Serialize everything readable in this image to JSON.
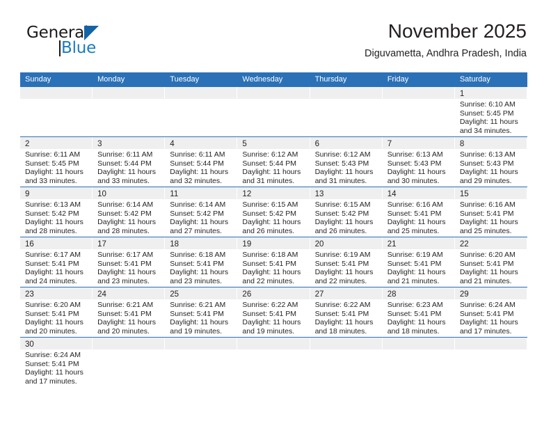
{
  "brand": {
    "name_part1": "General",
    "name_part2": "Blue",
    "triangle_color": "#1464a5",
    "blue_color": "#1b7ac4"
  },
  "header": {
    "title": "November 2025",
    "subtitle": "Diguvametta, Andhra Pradesh, India"
  },
  "theme": {
    "header_blue": "#2b71b8",
    "daynum_band": "#efefef",
    "text": "#231f20"
  },
  "weekday_headers": [
    "Sunday",
    "Monday",
    "Tuesday",
    "Wednesday",
    "Thursday",
    "Friday",
    "Saturday"
  ],
  "weeks": [
    [
      {
        "day": "",
        "sunrise": "",
        "sunset": "",
        "daylight_line1": "",
        "daylight_line2": ""
      },
      {
        "day": "",
        "sunrise": "",
        "sunset": "",
        "daylight_line1": "",
        "daylight_line2": ""
      },
      {
        "day": "",
        "sunrise": "",
        "sunset": "",
        "daylight_line1": "",
        "daylight_line2": ""
      },
      {
        "day": "",
        "sunrise": "",
        "sunset": "",
        "daylight_line1": "",
        "daylight_line2": ""
      },
      {
        "day": "",
        "sunrise": "",
        "sunset": "",
        "daylight_line1": "",
        "daylight_line2": ""
      },
      {
        "day": "",
        "sunrise": "",
        "sunset": "",
        "daylight_line1": "",
        "daylight_line2": ""
      },
      {
        "day": "1",
        "sunrise": "Sunrise: 6:10 AM",
        "sunset": "Sunset: 5:45 PM",
        "daylight_line1": "Daylight: 11 hours",
        "daylight_line2": "and 34 minutes."
      }
    ],
    [
      {
        "day": "2",
        "sunrise": "Sunrise: 6:11 AM",
        "sunset": "Sunset: 5:45 PM",
        "daylight_line1": "Daylight: 11 hours",
        "daylight_line2": "and 33 minutes."
      },
      {
        "day": "3",
        "sunrise": "Sunrise: 6:11 AM",
        "sunset": "Sunset: 5:44 PM",
        "daylight_line1": "Daylight: 11 hours",
        "daylight_line2": "and 33 minutes."
      },
      {
        "day": "4",
        "sunrise": "Sunrise: 6:11 AM",
        "sunset": "Sunset: 5:44 PM",
        "daylight_line1": "Daylight: 11 hours",
        "daylight_line2": "and 32 minutes."
      },
      {
        "day": "5",
        "sunrise": "Sunrise: 6:12 AM",
        "sunset": "Sunset: 5:44 PM",
        "daylight_line1": "Daylight: 11 hours",
        "daylight_line2": "and 31 minutes."
      },
      {
        "day": "6",
        "sunrise": "Sunrise: 6:12 AM",
        "sunset": "Sunset: 5:43 PM",
        "daylight_line1": "Daylight: 11 hours",
        "daylight_line2": "and 31 minutes."
      },
      {
        "day": "7",
        "sunrise": "Sunrise: 6:13 AM",
        "sunset": "Sunset: 5:43 PM",
        "daylight_line1": "Daylight: 11 hours",
        "daylight_line2": "and 30 minutes."
      },
      {
        "day": "8",
        "sunrise": "Sunrise: 6:13 AM",
        "sunset": "Sunset: 5:43 PM",
        "daylight_line1": "Daylight: 11 hours",
        "daylight_line2": "and 29 minutes."
      }
    ],
    [
      {
        "day": "9",
        "sunrise": "Sunrise: 6:13 AM",
        "sunset": "Sunset: 5:42 PM",
        "daylight_line1": "Daylight: 11 hours",
        "daylight_line2": "and 28 minutes."
      },
      {
        "day": "10",
        "sunrise": "Sunrise: 6:14 AM",
        "sunset": "Sunset: 5:42 PM",
        "daylight_line1": "Daylight: 11 hours",
        "daylight_line2": "and 28 minutes."
      },
      {
        "day": "11",
        "sunrise": "Sunrise: 6:14 AM",
        "sunset": "Sunset: 5:42 PM",
        "daylight_line1": "Daylight: 11 hours",
        "daylight_line2": "and 27 minutes."
      },
      {
        "day": "12",
        "sunrise": "Sunrise: 6:15 AM",
        "sunset": "Sunset: 5:42 PM",
        "daylight_line1": "Daylight: 11 hours",
        "daylight_line2": "and 26 minutes."
      },
      {
        "day": "13",
        "sunrise": "Sunrise: 6:15 AM",
        "sunset": "Sunset: 5:42 PM",
        "daylight_line1": "Daylight: 11 hours",
        "daylight_line2": "and 26 minutes."
      },
      {
        "day": "14",
        "sunrise": "Sunrise: 6:16 AM",
        "sunset": "Sunset: 5:41 PM",
        "daylight_line1": "Daylight: 11 hours",
        "daylight_line2": "and 25 minutes."
      },
      {
        "day": "15",
        "sunrise": "Sunrise: 6:16 AM",
        "sunset": "Sunset: 5:41 PM",
        "daylight_line1": "Daylight: 11 hours",
        "daylight_line2": "and 25 minutes."
      }
    ],
    [
      {
        "day": "16",
        "sunrise": "Sunrise: 6:17 AM",
        "sunset": "Sunset: 5:41 PM",
        "daylight_line1": "Daylight: 11 hours",
        "daylight_line2": "and 24 minutes."
      },
      {
        "day": "17",
        "sunrise": "Sunrise: 6:17 AM",
        "sunset": "Sunset: 5:41 PM",
        "daylight_line1": "Daylight: 11 hours",
        "daylight_line2": "and 23 minutes."
      },
      {
        "day": "18",
        "sunrise": "Sunrise: 6:18 AM",
        "sunset": "Sunset: 5:41 PM",
        "daylight_line1": "Daylight: 11 hours",
        "daylight_line2": "and 23 minutes."
      },
      {
        "day": "19",
        "sunrise": "Sunrise: 6:18 AM",
        "sunset": "Sunset: 5:41 PM",
        "daylight_line1": "Daylight: 11 hours",
        "daylight_line2": "and 22 minutes."
      },
      {
        "day": "20",
        "sunrise": "Sunrise: 6:19 AM",
        "sunset": "Sunset: 5:41 PM",
        "daylight_line1": "Daylight: 11 hours",
        "daylight_line2": "and 22 minutes."
      },
      {
        "day": "21",
        "sunrise": "Sunrise: 6:19 AM",
        "sunset": "Sunset: 5:41 PM",
        "daylight_line1": "Daylight: 11 hours",
        "daylight_line2": "and 21 minutes."
      },
      {
        "day": "22",
        "sunrise": "Sunrise: 6:20 AM",
        "sunset": "Sunset: 5:41 PM",
        "daylight_line1": "Daylight: 11 hours",
        "daylight_line2": "and 21 minutes."
      }
    ],
    [
      {
        "day": "23",
        "sunrise": "Sunrise: 6:20 AM",
        "sunset": "Sunset: 5:41 PM",
        "daylight_line1": "Daylight: 11 hours",
        "daylight_line2": "and 20 minutes."
      },
      {
        "day": "24",
        "sunrise": "Sunrise: 6:21 AM",
        "sunset": "Sunset: 5:41 PM",
        "daylight_line1": "Daylight: 11 hours",
        "daylight_line2": "and 20 minutes."
      },
      {
        "day": "25",
        "sunrise": "Sunrise: 6:21 AM",
        "sunset": "Sunset: 5:41 PM",
        "daylight_line1": "Daylight: 11 hours",
        "daylight_line2": "and 19 minutes."
      },
      {
        "day": "26",
        "sunrise": "Sunrise: 6:22 AM",
        "sunset": "Sunset: 5:41 PM",
        "daylight_line1": "Daylight: 11 hours",
        "daylight_line2": "and 19 minutes."
      },
      {
        "day": "27",
        "sunrise": "Sunrise: 6:22 AM",
        "sunset": "Sunset: 5:41 PM",
        "daylight_line1": "Daylight: 11 hours",
        "daylight_line2": "and 18 minutes."
      },
      {
        "day": "28",
        "sunrise": "Sunrise: 6:23 AM",
        "sunset": "Sunset: 5:41 PM",
        "daylight_line1": "Daylight: 11 hours",
        "daylight_line2": "and 18 minutes."
      },
      {
        "day": "29",
        "sunrise": "Sunrise: 6:24 AM",
        "sunset": "Sunset: 5:41 PM",
        "daylight_line1": "Daylight: 11 hours",
        "daylight_line2": "and 17 minutes."
      }
    ],
    [
      {
        "day": "30",
        "sunrise": "Sunrise: 6:24 AM",
        "sunset": "Sunset: 5:41 PM",
        "daylight_line1": "Daylight: 11 hours",
        "daylight_line2": "and 17 minutes."
      },
      {
        "day": "",
        "sunrise": "",
        "sunset": "",
        "daylight_line1": "",
        "daylight_line2": ""
      },
      {
        "day": "",
        "sunrise": "",
        "sunset": "",
        "daylight_line1": "",
        "daylight_line2": ""
      },
      {
        "day": "",
        "sunrise": "",
        "sunset": "",
        "daylight_line1": "",
        "daylight_line2": ""
      },
      {
        "day": "",
        "sunrise": "",
        "sunset": "",
        "daylight_line1": "",
        "daylight_line2": ""
      },
      {
        "day": "",
        "sunrise": "",
        "sunset": "",
        "daylight_line1": "",
        "daylight_line2": ""
      },
      {
        "day": "",
        "sunrise": "",
        "sunset": "",
        "daylight_line1": "",
        "daylight_line2": ""
      }
    ]
  ]
}
